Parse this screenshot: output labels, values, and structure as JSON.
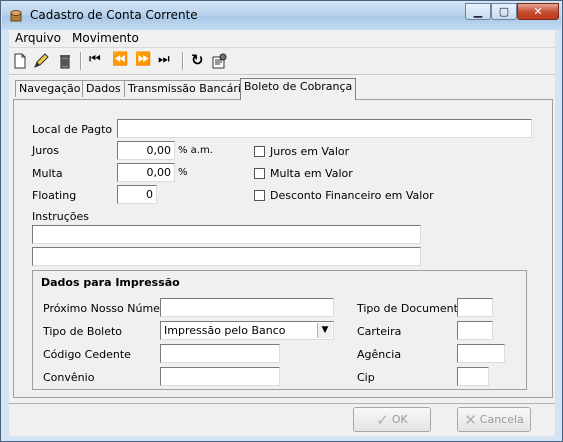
{
  "window": {
    "title": "Cadastro de Conta Corrente",
    "controls": {
      "minimize": "▁",
      "maximize": "▢",
      "close": "✕"
    }
  },
  "menu": [
    {
      "label": "Arquivo"
    },
    {
      "label": "Movimento"
    }
  ],
  "toolbar": {
    "icons": [
      "new-icon",
      "edit-icon",
      "delete-icon",
      "first-icon",
      "prev-icon",
      "next-icon",
      "last-icon",
      "refresh-icon",
      "properties-icon"
    ],
    "glyphs": {
      "first": "⏮",
      "prev": "⏪",
      "next": "⏩",
      "last": "⏭",
      "refresh": "↻"
    }
  },
  "tabs": [
    {
      "label": "Navegação",
      "active": false
    },
    {
      "label": "Dados",
      "active": false
    },
    {
      "label": "Transmissão Bancária",
      "active": false
    },
    {
      "label": "Boleto de Cobrança",
      "active": true
    }
  ],
  "form": {
    "local_pagto": {
      "label": "Local de Pagto",
      "value": ""
    },
    "juros": {
      "label": "Juros",
      "value": "0,00",
      "unit": "% a.m."
    },
    "multa": {
      "label": "Multa",
      "value": "0,00",
      "unit": "%"
    },
    "floating": {
      "label": "Floating",
      "value": "0"
    },
    "checkboxes": {
      "juros_valor": {
        "label": "Juros em Valor",
        "checked": false
      },
      "multa_valor": {
        "label": "Multa em Valor",
        "checked": false
      },
      "desconto_valor": {
        "label": "Desconto Financeiro em Valor",
        "checked": false
      }
    },
    "instrucoes": {
      "label": "Instruções",
      "line1": "",
      "line2": ""
    }
  },
  "impressao": {
    "title": "Dados para Impressão",
    "proximo_nosso_numero": {
      "label": "Próximo Nosso Número",
      "value": ""
    },
    "tipo_boleto": {
      "label": "Tipo de Boleto",
      "value": "Impressão pelo Banco"
    },
    "codigo_cedente": {
      "label": "Código Cedente",
      "value": ""
    },
    "convenio": {
      "label": "Convênio",
      "value": ""
    },
    "tipo_documento": {
      "label": "Tipo de Documento",
      "value": ""
    },
    "carteira": {
      "label": "Carteira",
      "value": ""
    },
    "agencia": {
      "label": "Agência",
      "value": ""
    },
    "cip": {
      "label": "Cip",
      "value": ""
    }
  },
  "buttons": {
    "ok": {
      "label": "OK",
      "icon": "✓"
    },
    "cancel": {
      "label": "Cancela",
      "icon": "✕"
    }
  },
  "colors": {
    "title_bar": "#b6d0ea",
    "close_button": "#c44a2e",
    "client_bg": "#f0f0f0"
  }
}
